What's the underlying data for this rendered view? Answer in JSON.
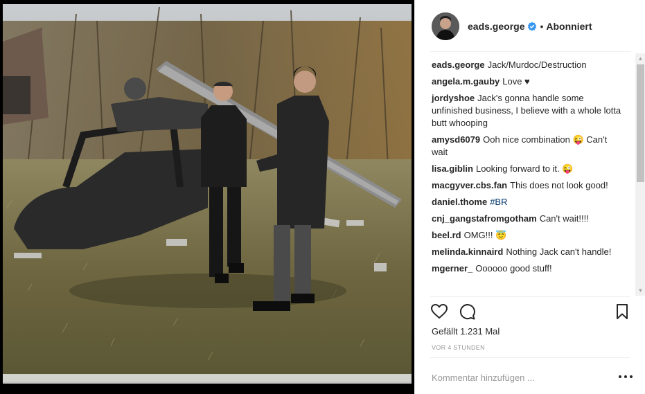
{
  "post": {
    "author": "eads.george",
    "follow_status": "Abonniert",
    "separator": "•",
    "likes_text": "Gefällt 1.231 Mal",
    "time_text": "VOR 4 STUNDEN",
    "comment_placeholder": "Kommentar hinzufügen ..."
  },
  "comments": [
    {
      "user": "eads.george",
      "text": "Jack/Murdoc/Destruction"
    },
    {
      "user": "angela.m.gauby",
      "text": "Love ♥"
    },
    {
      "user": "jordyshoe",
      "text": "Jack's gonna handle some unfinished business, I believe with a whole lotta butt whooping"
    },
    {
      "user": "amysd6079",
      "text": "Ooh nice combination 😜 Can't wait"
    },
    {
      "user": "lisa.giblin",
      "text": "Looking forward to it. 😜"
    },
    {
      "user": "macgyver.cbs.fan",
      "text": "This does not look good!"
    },
    {
      "user": "daniel.thome",
      "text": "#BR"
    },
    {
      "user": "cnj_gangstafromgotham",
      "text": "Can't wait!!!!"
    },
    {
      "user": "beel.rd",
      "text": "OMG!!! 😇"
    },
    {
      "user": "melinda.kinnaird",
      "text": "Nothing Jack can't handle!"
    },
    {
      "user": "mgerner_",
      "text": "Oooooo good stuff!"
    }
  ],
  "icons": {
    "like": "heart-icon",
    "comment": "speech-bubble-icon",
    "save": "bookmark-icon",
    "verified": "verified-badge-icon",
    "more": "more-options-icon"
  },
  "colors": {
    "text": "#262626",
    "muted": "#999999",
    "verified_blue": "#3897f0",
    "hashtag": "#003569",
    "divider": "#efefef"
  }
}
